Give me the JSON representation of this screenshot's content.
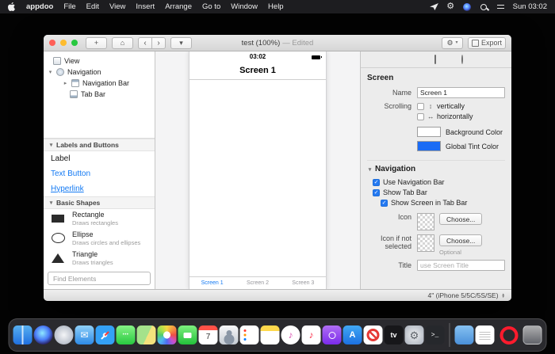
{
  "icons": {
    "gear": "⚙",
    "home": "⌂",
    "back": "‹",
    "forward": "›",
    "chevron_down": "▾",
    "disclosure_open": "▾",
    "disclosure_closed": "▸",
    "scroll_vertical": "↕",
    "scroll_horizontal": "↔",
    "check": "✓",
    "stepper_up": "▲",
    "stepper_down": "▼",
    "plus": "+"
  },
  "menubar": {
    "app_name": "appdoo",
    "menus": [
      "File",
      "Edit",
      "View",
      "Insert",
      "Arrange",
      "Go to",
      "Window",
      "Help"
    ],
    "clock": "Sun 03:02"
  },
  "window": {
    "title": "test (100%)",
    "edited_suffix": "— Edited",
    "toolbar": {
      "export_label": "Export"
    },
    "outline": {
      "items": [
        {
          "label": "View"
        },
        {
          "label": "Navigation"
        },
        {
          "label": "Navigation Bar"
        },
        {
          "label": "Tab Bar"
        }
      ]
    },
    "library": {
      "sections": [
        {
          "title": "Labels and Buttons"
        },
        {
          "title": "Basic Shapes"
        }
      ],
      "labels_items": [
        {
          "label": "Label"
        },
        {
          "label": "Text Button"
        },
        {
          "label": "Hyperlink"
        }
      ],
      "shapes_items": [
        {
          "label": "Rectangle",
          "desc": "Draws rectangles"
        },
        {
          "label": "Ellipse",
          "desc": "Draws circles and ellipses"
        },
        {
          "label": "Triangle",
          "desc": "Draws triangles"
        }
      ],
      "search_placeholder": "Find Elements"
    },
    "canvas": {
      "status_time": "03:02",
      "nav_title": "Screen 1",
      "tabs": [
        {
          "label": "Screen 1"
        },
        {
          "label": "Screen 2"
        },
        {
          "label": "Screen 3"
        }
      ]
    },
    "inspector": {
      "section_screen": "Screen",
      "name_label": "Name",
      "name_value": "Screen 1",
      "scrolling_label": "Scrolling",
      "scroll_vertical_label": "vertically",
      "scroll_horizontal_label": "horizontally",
      "background_color_label": "Background Color",
      "tint_color_label": "Global Tint Color",
      "navigation_section": "Navigation",
      "use_navigation_bar": "Use Navigation Bar",
      "show_tab_bar": "Show Tab Bar",
      "show_screen_in_tab_bar": "Show Screen in Tab Bar",
      "icon_label": "Icon",
      "choose_label": "Choose...",
      "icon_not_selected_label": "Icon if not selected",
      "optional_label": "Optional",
      "title_label": "Title",
      "title_placeholder": "use Screen Title"
    },
    "status_device": "4\" (iPhone 5/5C/5S/SE)"
  },
  "dock": {
    "apps": [
      "finder",
      "siri",
      "launchpad",
      "mail",
      "safari",
      "messages",
      "maps",
      "photos",
      "facetime",
      "calendar",
      "contacts",
      "reminders",
      "notes",
      "itunes",
      "music",
      "podcasts",
      "app-store",
      "blocked",
      "tv",
      "system-preferences",
      "terminal",
      "separator",
      "downloads-folder",
      "textedit",
      "opera",
      "trash"
    ]
  },
  "colors": {
    "accent_blue": "#147af3",
    "tint_swatch_blue": "#1b6cf5"
  }
}
